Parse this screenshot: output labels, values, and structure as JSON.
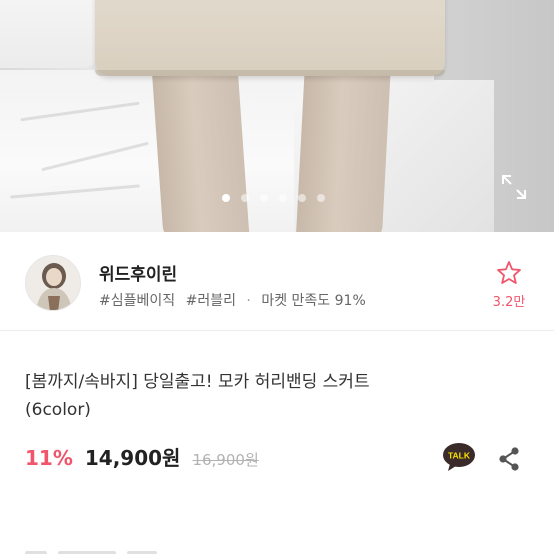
{
  "hero": {
    "image_alt": "product photo — beige wool mini skirt",
    "slides_total": 6,
    "slide_active": 1
  },
  "seller": {
    "name": "위드후이린",
    "tag1": "#심플베이직",
    "tag2": "#러블리",
    "satisfaction": "마켓 만족도 91%",
    "favorites": "3.2만"
  },
  "product": {
    "title_line1": "[봄까지/속바지] 당일출고! 모카 허리밴딩 스커트",
    "title_line2": "(6color)",
    "discount": "11%",
    "price": "14,900원",
    "original_price": "16,900원"
  },
  "icons": {
    "expand": "expand-icon",
    "star": "star-outline-icon",
    "talk": "kakao-talk-icon",
    "share": "share-icon"
  },
  "colors": {
    "accent": "#f0556b",
    "talk_bg": "#3b2a2a",
    "talk_text": "#f6e000"
  }
}
